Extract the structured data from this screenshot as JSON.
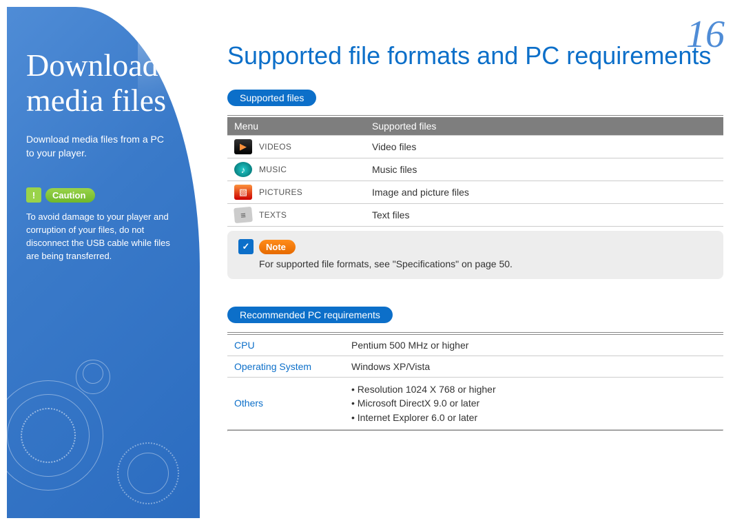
{
  "page_number": "16",
  "sidebar": {
    "title_line1": "Download",
    "title_line2": "media files",
    "subtitle": "Download media files from a PC to your player.",
    "caution_label": "Caution",
    "caution_text": "To avoid damage to your player and corruption of your files, do not disconnect the USB cable while files are being transferred."
  },
  "main": {
    "title": "Supported file formats and PC requirements",
    "section1": {
      "heading": "Supported files",
      "table": {
        "head_menu": "Menu",
        "head_supported": "Supported files",
        "rows": [
          {
            "menu": "VIDEOS",
            "desc": "Video files",
            "icon": "video"
          },
          {
            "menu": "MUSIC",
            "desc": "Music files",
            "icon": "music"
          },
          {
            "menu": "PICTURES",
            "desc": "Image and picture files",
            "icon": "pic"
          },
          {
            "menu": "TEXTS",
            "desc": "Text files",
            "icon": "text"
          }
        ]
      },
      "note_label": "Note",
      "note_text": "For supported file formats, see \"Specifications\" on page 50."
    },
    "section2": {
      "heading": "Recommended PC requirements",
      "rows": {
        "cpu_label": "CPU",
        "cpu_value": "Pentium 500 MHz or higher",
        "os_label": "Operating System",
        "os_value": "Windows XP/Vista",
        "others_label": "Others",
        "others_values": [
          "Resolution 1024 X 768 or higher",
          "Microsoft DirectX 9.0 or later",
          "Internet Explorer 6.0 or later"
        ]
      }
    }
  }
}
